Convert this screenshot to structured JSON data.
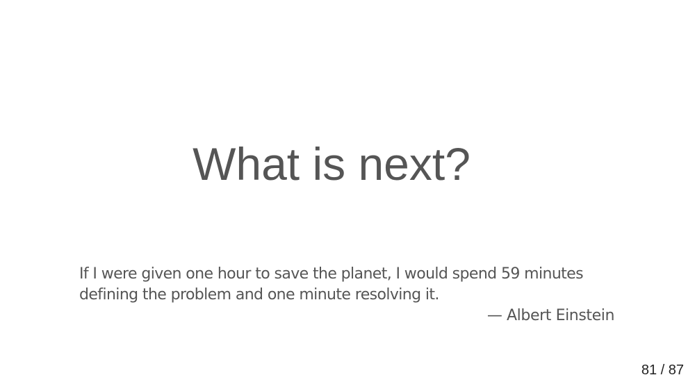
{
  "slide": {
    "title": "What is next?",
    "quote": {
      "text": "If I were given one hour to save the planet, I would spend 59 minutes defining the problem and one minute resolving it.",
      "author": "— Albert Einstein"
    }
  },
  "navigation": {
    "page_counter": "81 / 87"
  },
  "colors": {
    "background": "#ffffff",
    "text": "#555555",
    "counter": "#222222"
  }
}
